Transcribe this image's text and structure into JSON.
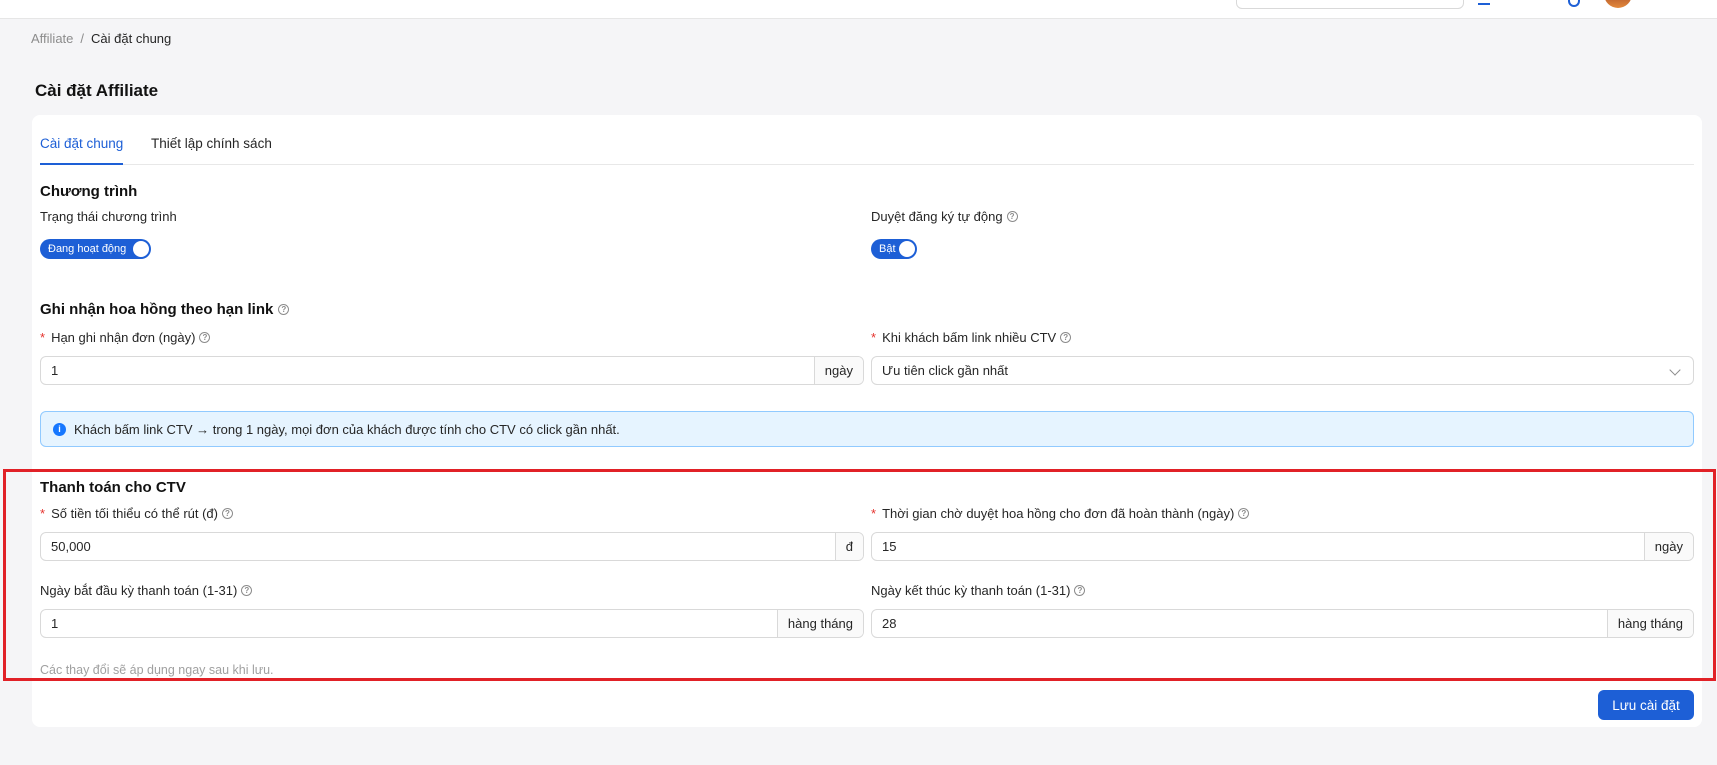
{
  "breadcrumb": {
    "root": "Affiliate",
    "separator": "/",
    "current": "Cài đặt chung"
  },
  "page": {
    "title": "Cài đặt Affiliate"
  },
  "tabs": [
    {
      "label": "Cài đặt chung",
      "active": true
    },
    {
      "label": "Thiết lập chính sách",
      "active": false
    }
  ],
  "program": {
    "title": "Chương trình",
    "status_label": "Trạng thái chương trình",
    "status_toggle": "Đang hoạt động",
    "auto_approve_label": "Duyệt đăng ký tự động",
    "auto_approve_toggle": "Bật"
  },
  "commission": {
    "title": "Ghi nhận hoa hồng theo hạn link",
    "window_label": "Hạn ghi nhận đơn (ngày)",
    "window_value": "1",
    "window_unit": "ngày",
    "multi_click_label": "Khi khách bấm link nhiều CTV",
    "multi_click_value": "Ưu tiên click gần nhất",
    "info": "Khách bấm link CTV → trong 1 ngày, mọi đơn của khách được tính cho CTV có click gần nhất."
  },
  "payment": {
    "title": "Thanh toán cho CTV",
    "min_withdraw_label": "Số tiền tối thiểu có thể rút (đ)",
    "min_withdraw_value": "50,000",
    "min_withdraw_unit": "đ",
    "wait_label": "Thời gian chờ duyệt hoa hồng cho đơn đã hoàn thành (ngày)",
    "wait_value": "15",
    "wait_unit": "ngày",
    "start_day_label": "Ngày bắt đầu kỳ thanh toán (1-31)",
    "start_day_value": "1",
    "start_day_unit": "hàng tháng",
    "end_day_label": "Ngày kết thúc kỳ thanh toán (1-31)",
    "end_day_value": "28",
    "end_day_unit": "hàng tháng"
  },
  "footer": {
    "note": "Các thay đổi sẽ áp dụng ngay sau khi lưu.",
    "save_label": "Lưu cài đặt"
  },
  "symbols": {
    "required": "*",
    "help": "?",
    "info": "i"
  },
  "colors": {
    "primary": "#1d5fd6",
    "highlight": "#e12127",
    "info_bg": "#e6f4ff"
  }
}
